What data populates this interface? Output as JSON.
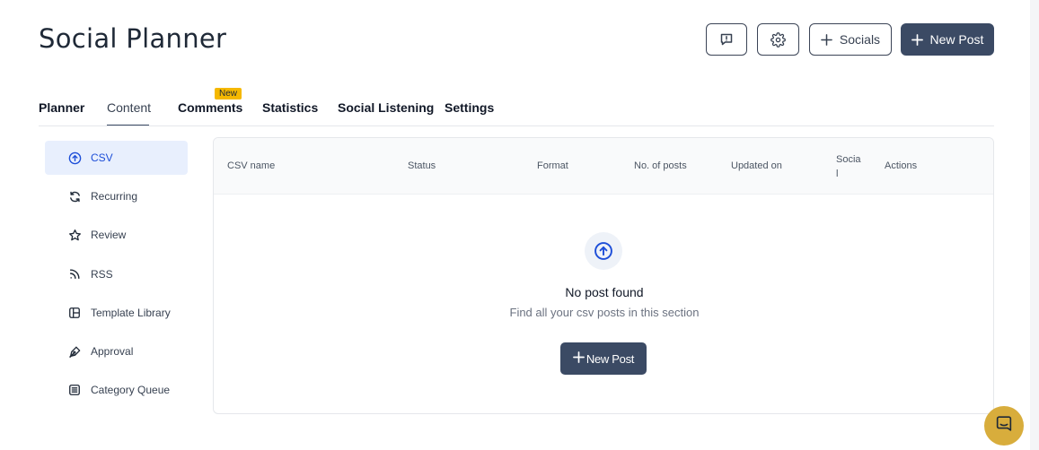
{
  "header": {
    "title": "Social Planner",
    "feedback_icon": "message-alert-icon",
    "settings_icon": "gear-icon",
    "socials_label": "Socials",
    "new_post_label": "New Post"
  },
  "tabs": [
    {
      "label": "Planner",
      "active": false
    },
    {
      "label": "Content",
      "active": true
    },
    {
      "label": "Comments",
      "active": false,
      "badge": "New"
    },
    {
      "label": "Statistics",
      "active": false
    },
    {
      "label": "Social Listening",
      "active": false
    },
    {
      "label": "Settings",
      "active": false
    }
  ],
  "sidebar": {
    "items": [
      {
        "label": "CSV",
        "icon": "upload-circle-icon",
        "active": true
      },
      {
        "label": "Recurring",
        "icon": "refresh-icon",
        "active": false
      },
      {
        "label": "Review",
        "icon": "star-icon",
        "active": false
      },
      {
        "label": "RSS",
        "icon": "rss-icon",
        "active": false
      },
      {
        "label": "Template Library",
        "icon": "layout-icon",
        "active": false
      },
      {
        "label": "Approval",
        "icon": "pen-icon",
        "active": false
      },
      {
        "label": "Category Queue",
        "icon": "list-icon",
        "active": false
      }
    ]
  },
  "table": {
    "columns": [
      "CSV name",
      "Status",
      "Format",
      "No. of posts",
      "Updated on",
      "Social",
      "Actions"
    ],
    "rows": []
  },
  "empty_state": {
    "icon": "upload-circle-icon",
    "title": "No post found",
    "subtitle": "Find all your csv posts in this section",
    "button_label": "New Post"
  },
  "chat_widget": {
    "icon": "chat-icon"
  },
  "colors": {
    "primary": "#3b4a64",
    "active_bg": "#e8effd",
    "active_text": "#1d4ed8",
    "badge": "#f5b800",
    "chat": "#d8ad3c"
  }
}
